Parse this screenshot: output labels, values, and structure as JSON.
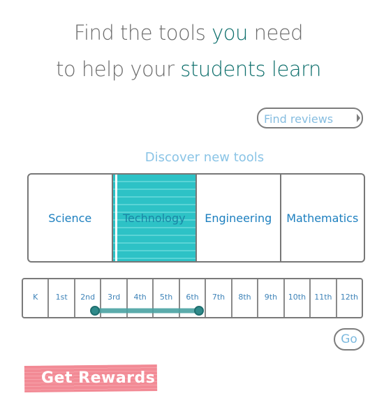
{
  "headline": {
    "line1_pre": "Find the tools ",
    "line1_accent": "you",
    "line1_post": " need",
    "line2_pre": "to help your ",
    "line2_accent": "students learn"
  },
  "find_reviews": {
    "label": "Find reviews"
  },
  "discover": {
    "label": "Discover new tools"
  },
  "subjects": {
    "items": [
      "Science",
      "Technology",
      "Engineering",
      "Mathematics"
    ],
    "selected": "Technology"
  },
  "grades": {
    "items": [
      "K",
      "1st",
      "2nd",
      "3rd",
      "4th",
      "5th",
      "6th",
      "7th",
      "8th",
      "9th",
      "10th",
      "11th",
      "12th"
    ],
    "range_start": "2nd",
    "range_end": "6th"
  },
  "go_button": {
    "label": "Go"
  },
  "rewards_button": {
    "label": "Get Rewards"
  },
  "colors": {
    "accent_teal": "#0e6f6c",
    "selected_subject": "#2dc2c6",
    "range_slider": "#4aa3a3",
    "rewards_pink": "#f28a95",
    "link_blue": "#1c7fbf"
  }
}
